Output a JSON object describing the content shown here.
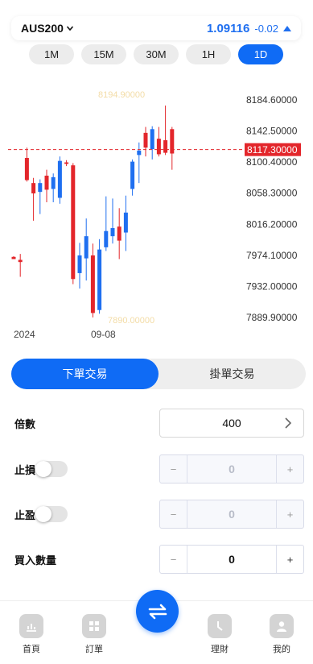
{
  "header": {
    "symbol": "AUS200",
    "price": "1.09116",
    "change": "-0.02"
  },
  "timeframes": [
    {
      "label": "1M",
      "active": false
    },
    {
      "label": "15M",
      "active": false
    },
    {
      "label": "30M",
      "active": false
    },
    {
      "label": "1H",
      "active": false
    },
    {
      "label": "1D",
      "active": true
    }
  ],
  "chart_data": {
    "type": "candlestick",
    "y_ticks": [
      "8184.60000",
      "8142.50000",
      "8100.40000",
      "8058.30000",
      "8016.20000",
      "7974.10000",
      "7932.00000",
      "7889.90000"
    ],
    "ylim": [
      7889.9,
      8184.6
    ],
    "x_labels": [
      "2024",
      "09-08"
    ],
    "current_price_label": "8117.30000",
    "current_price": 8117.3,
    "high_watermark": "8194.90000",
    "low_watermark": "7890.00000",
    "up_color": "#1f6ff0",
    "down_color": "#e3262b",
    "candles": [
      {
        "o": 7972,
        "h": 7973,
        "l": 7970,
        "c": 7969
      },
      {
        "o": 7968,
        "h": 7976,
        "l": 7945,
        "c": 7965
      },
      {
        "o": 8106,
        "h": 8120,
        "l": 8074,
        "c": 8076
      },
      {
        "o": 8072,
        "h": 8079,
        "l": 8021,
        "c": 8058
      },
      {
        "o": 8060,
        "h": 8077,
        "l": 8030,
        "c": 8072
      },
      {
        "o": 8082,
        "h": 8090,
        "l": 8046,
        "c": 8063
      },
      {
        "o": 8064,
        "h": 8085,
        "l": 8046,
        "c": 8080
      },
      {
        "o": 8052,
        "h": 8108,
        "l": 8044,
        "c": 8102
      },
      {
        "o": 8100,
        "h": 8103,
        "l": 8095,
        "c": 8098
      },
      {
        "o": 8096,
        "h": 8099,
        "l": 7935,
        "c": 7942
      },
      {
        "o": 7950,
        "h": 7991,
        "l": 7929,
        "c": 7974
      },
      {
        "o": 7970,
        "h": 8024,
        "l": 7940,
        "c": 8000
      },
      {
        "o": 7974,
        "h": 7990,
        "l": 7890,
        "c": 7896
      },
      {
        "o": 7900,
        "h": 7996,
        "l": 7895,
        "c": 7982
      },
      {
        "o": 7985,
        "h": 8054,
        "l": 7980,
        "c": 8007
      },
      {
        "o": 8000,
        "h": 8051,
        "l": 7990,
        "c": 8011
      },
      {
        "o": 8013,
        "h": 8038,
        "l": 7969,
        "c": 7994
      },
      {
        "o": 8005,
        "h": 8055,
        "l": 7980,
        "c": 8032
      },
      {
        "o": 8064,
        "h": 8104,
        "l": 8055,
        "c": 8101
      },
      {
        "o": 8110,
        "h": 8127,
        "l": 8072,
        "c": 8116
      },
      {
        "o": 8140,
        "h": 8148,
        "l": 8108,
        "c": 8120
      },
      {
        "o": 8118,
        "h": 8149,
        "l": 8104,
        "c": 8145
      },
      {
        "o": 8132,
        "h": 8148,
        "l": 8108,
        "c": 8111
      },
      {
        "o": 8130,
        "h": 8177,
        "l": 8110,
        "c": 8113
      },
      {
        "o": 8145,
        "h": 8148,
        "l": 8090,
        "c": 8112
      }
    ]
  },
  "order_tabs": {
    "market": "下單交易",
    "pending": "掛單交易"
  },
  "form": {
    "leverage_label": "倍數",
    "leverage_value": "400",
    "stop_loss_label": "止損",
    "stop_loss_value": "0",
    "take_profit_label": "止盈",
    "take_profit_value": "0",
    "quantity_label": "買入數量",
    "quantity_value": "0",
    "minus_symbol": "−",
    "plus_symbol": "+"
  },
  "bottom_nav": [
    {
      "label": "首頁",
      "icon": "chart-icon"
    },
    {
      "label": "訂單",
      "icon": "grid-icon"
    },
    {
      "label": "",
      "icon": "swap-icon"
    },
    {
      "label": "理財",
      "icon": "clock-icon"
    },
    {
      "label": "我的",
      "icon": "user-icon"
    }
  ]
}
